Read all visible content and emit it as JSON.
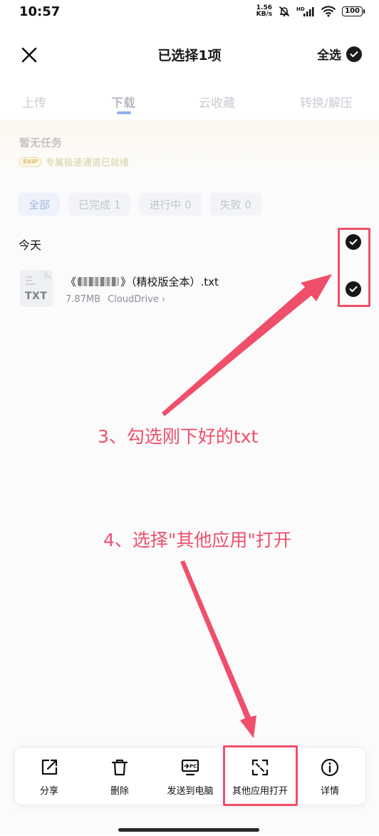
{
  "status_bar": {
    "time": "10:57",
    "net_speed_value": "1.56",
    "net_speed_unit": "KB/s",
    "signal_label": "HD",
    "battery": "100"
  },
  "header": {
    "title": "已选择1项",
    "select_all": "全选"
  },
  "tabs": [
    {
      "label": "上传"
    },
    {
      "label": "下载",
      "active": true
    },
    {
      "label": "云收藏"
    },
    {
      "label": "转换/解压"
    }
  ],
  "banner": {
    "title": "暂无任务",
    "badge": "SVIP",
    "subtitle": "专属极速通道已就绪"
  },
  "filters": [
    {
      "label": "全部",
      "active": true
    },
    {
      "label": "已完成 1"
    },
    {
      "label": "进行中 0"
    },
    {
      "label": "失败 0"
    }
  ],
  "group": {
    "label": "今天"
  },
  "file": {
    "name_prefix": "《",
    "name_suffix": "》（精校版全本）.txt",
    "ext": "TXT",
    "size": "7.87MB",
    "source": "CloudDrive ›",
    "selected": true
  },
  "annotations": {
    "step3": "3、勾选刚下好的txt",
    "step4": "4、选择\"其他应用\"打开"
  },
  "toolbar": [
    {
      "label": "分享",
      "icon": "share-icon"
    },
    {
      "label": "删除",
      "icon": "trash-icon"
    },
    {
      "label": "发送到电脑",
      "icon": "send-to-pc-icon",
      "icon_text": "PC"
    },
    {
      "label": "其他应用打开",
      "icon": "open-with-icon",
      "highlighted": true
    },
    {
      "label": "详情",
      "icon": "info-icon"
    }
  ],
  "colors": {
    "annotation": "#ef4f6a",
    "tab_indicator": "#8fb0e8"
  }
}
